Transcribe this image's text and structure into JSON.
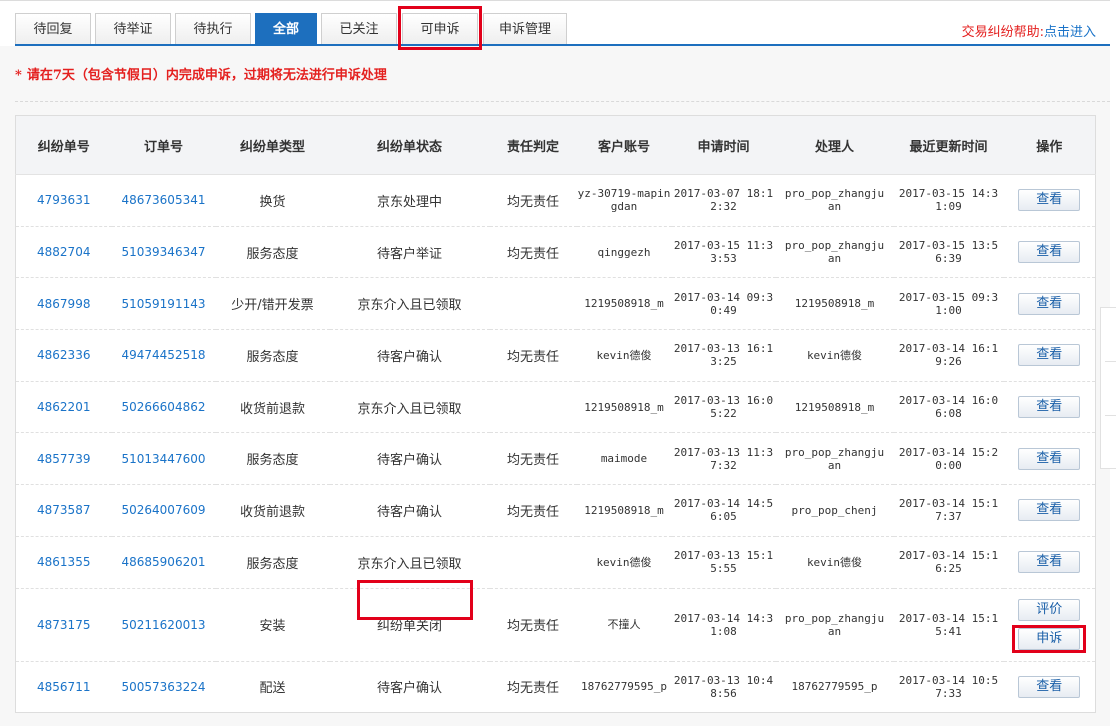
{
  "tabs": [
    {
      "label": "待回复",
      "active": false
    },
    {
      "label": "待举证",
      "active": false
    },
    {
      "label": "待执行",
      "active": false
    },
    {
      "label": "全部",
      "active": true
    },
    {
      "label": "已关注",
      "active": false
    },
    {
      "label": "可申诉",
      "active": false
    },
    {
      "label": "申诉管理",
      "active": false
    }
  ],
  "help": {
    "label": "交易纠纷帮助:",
    "link": "点击进入"
  },
  "notice": {
    "star": "*",
    "text": "请在7天（包含节假日）内完成申诉，过期将无法进行申诉处理"
  },
  "table": {
    "headers": [
      "纠纷单号",
      "订单号",
      "纠纷单类型",
      "纠纷单状态",
      "责任判定",
      "客户账号",
      "申请时间",
      "处理人",
      "最近更新时间",
      "操作"
    ],
    "rows": [
      {
        "dispute_id": "4793631",
        "order_id": "48673605341",
        "type": "换货",
        "status": "京东处理中",
        "liability": "均无责任",
        "account": "yz-30719-mapingdan",
        "apply_time": "2017-03-07 18:12:32",
        "handler": "pro_pop_zhangjuan",
        "update_time": "2017-03-15 14:31:09",
        "actions": [
          "查看"
        ]
      },
      {
        "dispute_id": "4882704",
        "order_id": "51039346347",
        "type": "服务态度",
        "status": "待客户举证",
        "liability": "均无责任",
        "account": "qinggezh",
        "apply_time": "2017-03-15 11:33:53",
        "handler": "pro_pop_zhangjuan",
        "update_time": "2017-03-15 13:56:39",
        "actions": [
          "查看"
        ]
      },
      {
        "dispute_id": "4867998",
        "order_id": "51059191143",
        "type": "少开/错开发票",
        "status": "京东介入且已领取",
        "liability": "",
        "account": "1219508918_m",
        "apply_time": "2017-03-14 09:30:49",
        "handler": "1219508918_m",
        "update_time": "2017-03-15 09:31:00",
        "actions": [
          "查看"
        ]
      },
      {
        "dispute_id": "4862336",
        "order_id": "49474452518",
        "type": "服务态度",
        "status": "待客户确认",
        "liability": "均无责任",
        "account": "kevin德俊",
        "apply_time": "2017-03-13 16:13:25",
        "handler": "kevin德俊",
        "update_time": "2017-03-14 16:19:26",
        "actions": [
          "查看"
        ]
      },
      {
        "dispute_id": "4862201",
        "order_id": "50266604862",
        "type": "收货前退款",
        "status": "京东介入且已领取",
        "liability": "",
        "account": "1219508918_m",
        "apply_time": "2017-03-13 16:05:22",
        "handler": "1219508918_m",
        "update_time": "2017-03-14 16:06:08",
        "actions": [
          "查看"
        ]
      },
      {
        "dispute_id": "4857739",
        "order_id": "51013447600",
        "type": "服务态度",
        "status": "待客户确认",
        "liability": "均无责任",
        "account": "maimode",
        "apply_time": "2017-03-13 11:37:32",
        "handler": "pro_pop_zhangjuan",
        "update_time": "2017-03-14 15:20:00",
        "actions": [
          "查看"
        ]
      },
      {
        "dispute_id": "4873587",
        "order_id": "50264007609",
        "type": "收货前退款",
        "status": "待客户确认",
        "liability": "均无责任",
        "account": "1219508918_m",
        "apply_time": "2017-03-14 14:56:05",
        "handler": "pro_pop_chenj",
        "update_time": "2017-03-14 15:17:37",
        "actions": [
          "查看"
        ]
      },
      {
        "dispute_id": "4861355",
        "order_id": "48685906201",
        "type": "服务态度",
        "status": "京东介入且已领取",
        "liability": "",
        "account": "kevin德俊",
        "apply_time": "2017-03-13 15:15:55",
        "handler": "kevin德俊",
        "update_time": "2017-03-14 15:16:25",
        "actions": [
          "查看"
        ]
      },
      {
        "dispute_id": "4873175",
        "order_id": "50211620013",
        "type": "安装",
        "status": "纠纷单关闭",
        "liability": "均无责任",
        "account": "不撞人",
        "apply_time": "2017-03-14 14:31:08",
        "handler": "pro_pop_zhangjuan",
        "update_time": "2017-03-14 15:15:41",
        "actions": [
          "评价",
          "申诉"
        ]
      },
      {
        "dispute_id": "4856711",
        "order_id": "50057363224",
        "type": "配送",
        "status": "待客户确认",
        "liability": "均无责任",
        "account": "18762779595_p",
        "apply_time": "2017-03-13 10:48:56",
        "handler": "18762779595_p",
        "update_time": "2017-03-14 10:57:33",
        "actions": [
          "查看"
        ]
      }
    ]
  },
  "colors": {
    "accent": "#1d6fbe",
    "link": "#1a73c8",
    "warning": "#e4201f",
    "highlight": "#e2001a"
  }
}
